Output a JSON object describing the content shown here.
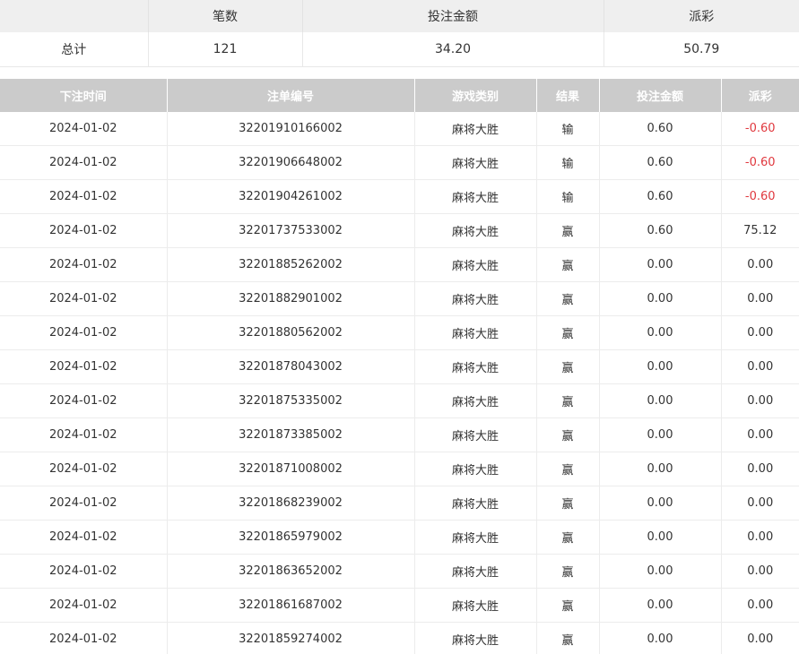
{
  "summary": {
    "headers": [
      "",
      "笔数",
      "投注金额",
      "派彩"
    ],
    "label": "总计",
    "count": "121",
    "bet_amount": "34.20",
    "payout": "50.79"
  },
  "records": {
    "headers": [
      "下注时间",
      "注单编号",
      "游戏类别",
      "结果",
      "投注金额",
      "派彩"
    ],
    "rows": [
      [
        "2024-01-02",
        "32201910166002",
        "麻将大胜",
        "输",
        "0.60",
        "-0.60"
      ],
      [
        "2024-01-02",
        "32201906648002",
        "麻将大胜",
        "输",
        "0.60",
        "-0.60"
      ],
      [
        "2024-01-02",
        "32201904261002",
        "麻将大胜",
        "输",
        "0.60",
        "-0.60"
      ],
      [
        "2024-01-02",
        "32201737533002",
        "麻将大胜",
        "赢",
        "0.60",
        "75.12"
      ],
      [
        "2024-01-02",
        "32201885262002",
        "麻将大胜",
        "赢",
        "0.00",
        "0.00"
      ],
      [
        "2024-01-02",
        "32201882901002",
        "麻将大胜",
        "赢",
        "0.00",
        "0.00"
      ],
      [
        "2024-01-02",
        "32201880562002",
        "麻将大胜",
        "赢",
        "0.00",
        "0.00"
      ],
      [
        "2024-01-02",
        "32201878043002",
        "麻将大胜",
        "赢",
        "0.00",
        "0.00"
      ],
      [
        "2024-01-02",
        "32201875335002",
        "麻将大胜",
        "赢",
        "0.00",
        "0.00"
      ],
      [
        "2024-01-02",
        "32201873385002",
        "麻将大胜",
        "赢",
        "0.00",
        "0.00"
      ],
      [
        "2024-01-02",
        "32201871008002",
        "麻将大胜",
        "赢",
        "0.00",
        "0.00"
      ],
      [
        "2024-01-02",
        "32201868239002",
        "麻将大胜",
        "赢",
        "0.00",
        "0.00"
      ],
      [
        "2024-01-02",
        "32201865979002",
        "麻将大胜",
        "赢",
        "0.00",
        "0.00"
      ],
      [
        "2024-01-02",
        "32201863652002",
        "麻将大胜",
        "赢",
        "0.00",
        "0.00"
      ],
      [
        "2024-01-02",
        "32201861687002",
        "麻将大胜",
        "赢",
        "0.00",
        "0.00"
      ],
      [
        "2024-01-02",
        "32201859274002",
        "麻将大胜",
        "赢",
        "0.00",
        "0.00"
      ]
    ]
  },
  "colors": {
    "negative": "#e0383e",
    "header_bg": "#cbcbcb",
    "summary_header_bg": "#efefef"
  }
}
